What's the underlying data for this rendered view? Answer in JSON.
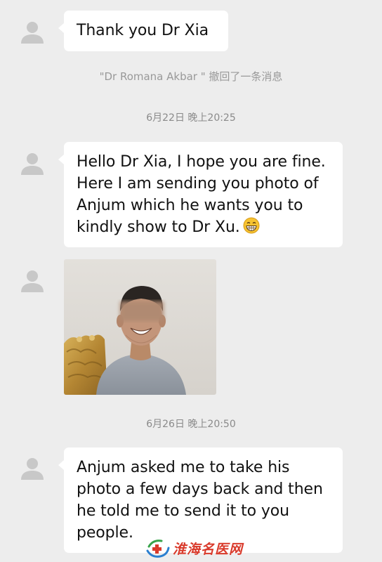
{
  "messages": [
    {
      "lines": [
        "Thank you Dr Xia"
      ]
    },
    {
      "lines": [
        "Hello Dr Xia, I hope you are fine.",
        "Here I am sending you photo of",
        "Anjum which he wants you to",
        "kindly show to Dr Xu."
      ],
      "emoji": "grinning-face-emoji"
    },
    {
      "image": "portrait-photo-blurred-eyes"
    },
    {
      "lines": [
        "Anjum asked me to take his",
        "photo a few days back and then",
        "he told me to send it to you",
        "people."
      ]
    }
  ],
  "system": {
    "recall_notice": "\"Dr Romana Akbar \" 撤回了一条消息"
  },
  "timestamps": [
    "6月22日 晚上20:25",
    "6月26日 晚上20:50"
  ],
  "watermark": {
    "text": "淮海名医网",
    "logo": "cross-swirl-logo"
  },
  "colors": {
    "background": "#ededed",
    "bubble": "#ffffff",
    "text": "#111111",
    "meta_text": "#999999",
    "avatar": "#c8c8c8",
    "watermark": "#d93a2b"
  }
}
